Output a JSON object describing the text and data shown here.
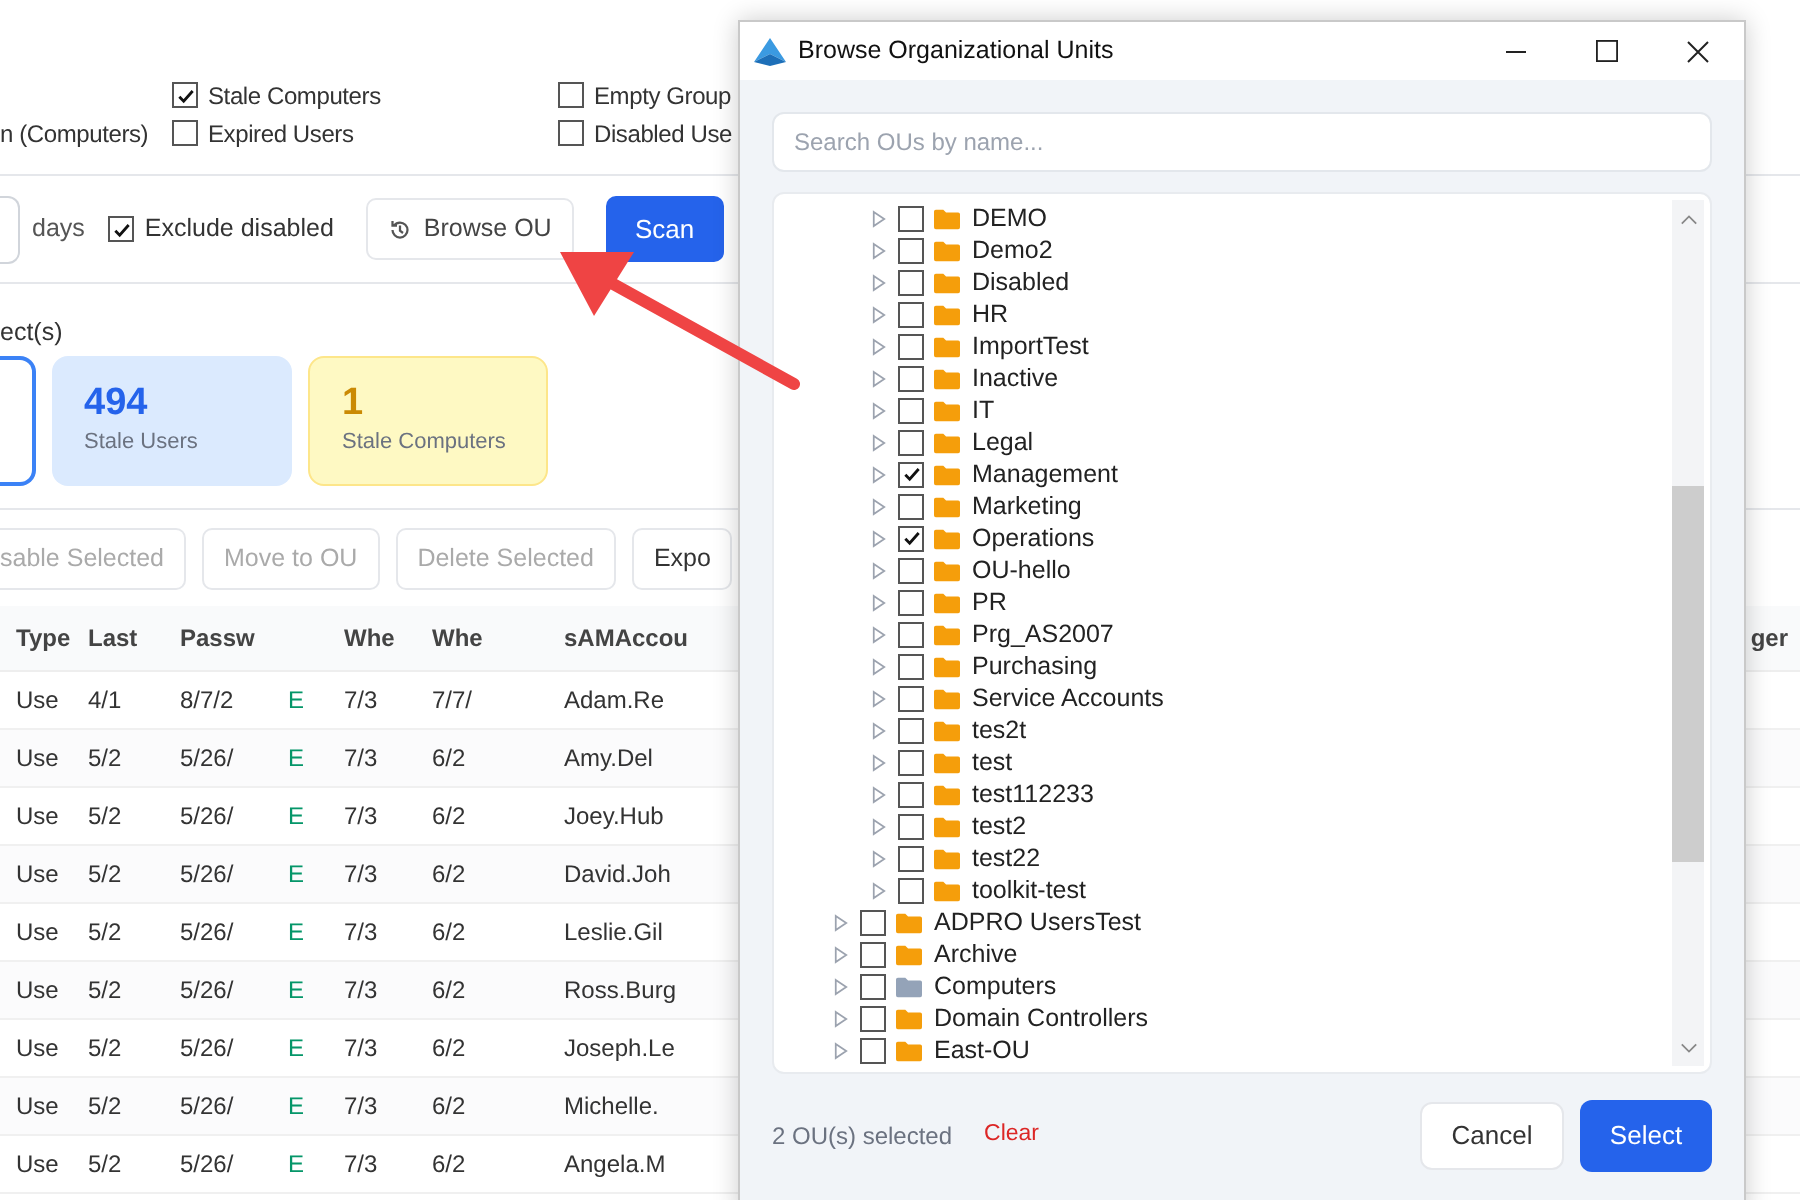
{
  "filters": {
    "column_1": [
      "n (Computers)"
    ],
    "options": [
      {
        "label": "Stale Computers",
        "checked": true
      },
      {
        "label": "Expired Users",
        "checked": false
      },
      {
        "label": "Empty Group",
        "checked": false
      },
      {
        "label": "Disabled Use",
        "checked": false
      }
    ]
  },
  "scan_bar": {
    "unit": "days",
    "exclude_disabled": {
      "label": "Exclude disabled",
      "checked": true
    },
    "browse_button": "Browse OU",
    "scan_button": "Scan"
  },
  "summary": {
    "heading": "ect(s)",
    "cards": [
      {
        "kind": "partial"
      },
      {
        "kind": "users",
        "count": "494",
        "label": "Stale Users"
      },
      {
        "kind": "computers",
        "count": "1",
        "label": "Stale Computers"
      }
    ]
  },
  "actions": [
    "sable Selected",
    "Move to OU",
    "Delete Selected",
    "Expo"
  ],
  "table": {
    "columns": [
      "Type",
      "Last",
      "Passw",
      null,
      "Whe",
      "Whe",
      "sAMAccou"
    ],
    "far_right_column": "ger",
    "rows": [
      [
        "Use",
        "4/1",
        "8/7/2",
        "E",
        "7/3",
        "7/7/",
        "Adam.Re"
      ],
      [
        "Use",
        "5/2",
        "5/26/",
        "E",
        "7/3",
        "6/2",
        "Amy.Del"
      ],
      [
        "Use",
        "5/2",
        "5/26/",
        "E",
        "7/3",
        "6/2",
        "Joey.Hub"
      ],
      [
        "Use",
        "5/2",
        "5/26/",
        "E",
        "7/3",
        "6/2",
        "David.Joh"
      ],
      [
        "Use",
        "5/2",
        "5/26/",
        "E",
        "7/3",
        "6/2",
        "Leslie.Gil"
      ],
      [
        "Use",
        "5/2",
        "5/26/",
        "E",
        "7/3",
        "6/2",
        "Ross.Burg"
      ],
      [
        "Use",
        "5/2",
        "5/26/",
        "E",
        "7/3",
        "6/2",
        "Joseph.Le"
      ],
      [
        "Use",
        "5/2",
        "5/26/",
        "E",
        "7/3",
        "6/2",
        "Michelle."
      ],
      [
        "Use",
        "5/2",
        "5/26/",
        "E",
        "7/3",
        "6/2",
        "Angela.M"
      ]
    ]
  },
  "dialog": {
    "title": "Browse Organizational Units",
    "search": {
      "placeholder": "Search OUs by name..."
    },
    "tree": [
      {
        "children": [
          {
            "label": "DEMO",
            "checked": false,
            "kind": "ou"
          },
          {
            "label": "Demo2",
            "checked": false,
            "kind": "ou"
          },
          {
            "label": "Disabled",
            "checked": false,
            "kind": "ou"
          },
          {
            "label": "HR",
            "checked": false,
            "kind": "ou"
          },
          {
            "label": "ImportTest",
            "checked": false,
            "kind": "ou"
          },
          {
            "label": "Inactive",
            "checked": false,
            "kind": "ou"
          },
          {
            "label": "IT",
            "checked": false,
            "kind": "ou"
          },
          {
            "label": "Legal",
            "checked": false,
            "kind": "ou"
          },
          {
            "label": "Management",
            "checked": true,
            "kind": "ou"
          },
          {
            "label": "Marketing",
            "checked": false,
            "kind": "ou"
          },
          {
            "label": "Operations",
            "checked": true,
            "kind": "ou"
          },
          {
            "label": "OU-hello",
            "checked": false,
            "kind": "ou"
          },
          {
            "label": "PR",
            "checked": false,
            "kind": "ou"
          },
          {
            "label": "Prg_AS2007",
            "checked": false,
            "kind": "ou"
          },
          {
            "label": "Purchasing",
            "checked": false,
            "kind": "ou"
          },
          {
            "label": "Service Accounts",
            "checked": false,
            "kind": "ou"
          },
          {
            "label": "tes2t",
            "checked": false,
            "kind": "ou"
          },
          {
            "label": "test",
            "checked": false,
            "kind": "ou"
          },
          {
            "label": "test112233",
            "checked": false,
            "kind": "ou"
          },
          {
            "label": "test2",
            "checked": false,
            "kind": "ou"
          },
          {
            "label": "test22",
            "checked": false,
            "kind": "ou"
          },
          {
            "label": "toolkit-test",
            "checked": false,
            "kind": "ou"
          }
        ]
      },
      {
        "label": "ADPRO UsersTest",
        "checked": false,
        "kind": "ou"
      },
      {
        "label": "Archive",
        "checked": false,
        "kind": "ou"
      },
      {
        "label": "Computers",
        "checked": false,
        "kind": "container"
      },
      {
        "label": "Domain Controllers",
        "checked": false,
        "kind": "ou"
      },
      {
        "label": "East-OU",
        "checked": false,
        "kind": "ou"
      }
    ],
    "footer": {
      "status": "2 OU(s) selected",
      "clear": "Clear",
      "cancel": "Cancel",
      "select": "Select"
    }
  }
}
